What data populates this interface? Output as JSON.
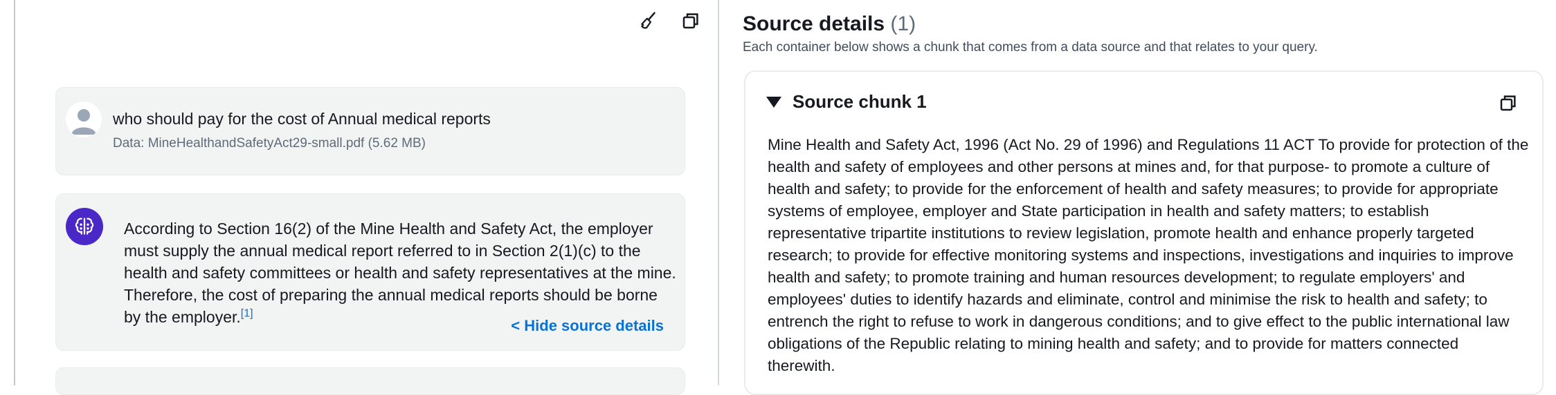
{
  "toolbar": {
    "clear_icon": "broom-icon",
    "copy_icon": "copy-icon"
  },
  "conversation": {
    "user_message": {
      "text": "who should pay for the cost of Annual medical reports",
      "data_label": "Data: MineHealthandSafetyAct29-small.pdf (5.62 MB)"
    },
    "assistant_message": {
      "text": "According to Section 16(2) of the Mine Health and Safety Act, the employer must supply the annual medical report referred to in Section 2(1)(c) to the health and safety committees or health and safety representatives at the mine. Therefore, the cost of preparing the annual medical reports should be borne by the employer.",
      "citation": "[1]",
      "hide_link": "< Hide source details"
    }
  },
  "source_details": {
    "title": "Source details",
    "count": "(1)",
    "subtitle": "Each container below shows a chunk that comes from a data source and that relates to your query.",
    "chunks": [
      {
        "title": "Source chunk 1",
        "text": "Mine Health and Safety Act, 1996 (Act No. 29 of 1996) and Regulations 11 ACT To provide for protection of the health and safety of employees and other persons at mines and, for that purpose- to promote a culture of health and safety; to provide for the enforcement of health and safety measures; to provide for appropriate systems of employee, employer and State participation in health and safety matters; to establish representative tripartite institutions to review legislation, promote health and enhance properly targeted research; to provide for effective monitoring systems and inspections, investigations and inquiries to improve health and safety; to promote training and human resources development; to regulate employers' and employees' duties to identify hazards and eliminate, control and minimise the risk to health and safety; to entrench the right to refuse to work in dangerous conditions; and to give effect to the public international law obligations of the Republic relating to mining health and safety; and to provide for matters connected therewith."
      }
    ]
  },
  "colors": {
    "accent": "#0972d3",
    "assistant_avatar": "#4a27c7",
    "card_bg": "#f2f3f3"
  }
}
